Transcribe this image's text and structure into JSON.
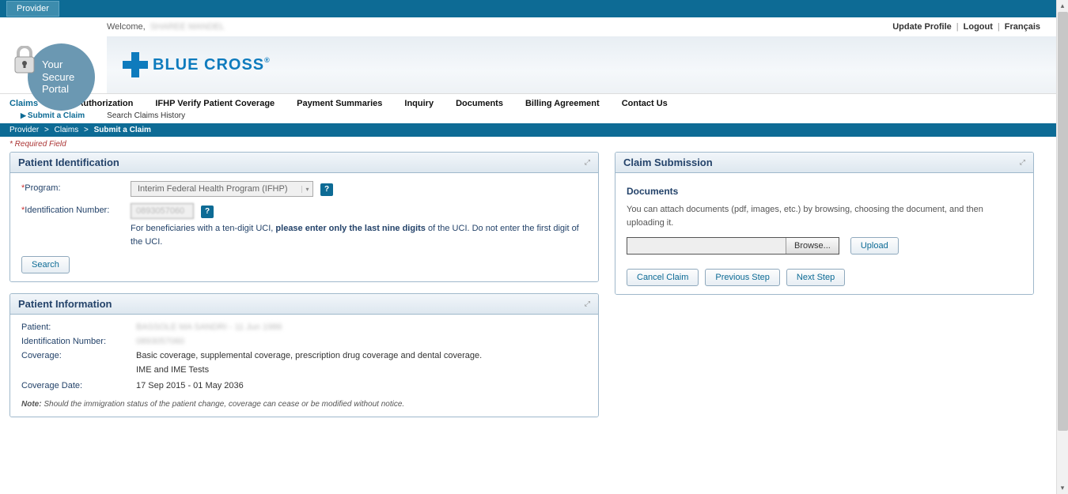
{
  "topbar": {
    "tab": "Provider"
  },
  "header": {
    "welcome_label": "Welcome,",
    "user_name": "SHAREE MANDEL",
    "links": {
      "update_profile": "Update Profile",
      "logout": "Logout",
      "francais": "Français"
    },
    "badge": {
      "line1": "Your",
      "line2": "Secure",
      "line3": "Portal"
    },
    "brand": "BLUE CROSS"
  },
  "nav": {
    "items": [
      "Claims",
      "Pre-Authorization",
      "IFHP Verify Patient Coverage",
      "Payment Summaries",
      "Inquiry",
      "Documents",
      "Billing Agreement",
      "Contact Us"
    ],
    "sub": {
      "submit": "Submit a Claim",
      "search": "Search Claims History"
    }
  },
  "breadcrumb": {
    "a": "Provider",
    "b": "Claims",
    "c": "Submit a Claim"
  },
  "required_note": "* Required Field",
  "patient_id": {
    "title": "Patient Identification",
    "program_label": "Program:",
    "program_value": "Interim Federal Health Program (IFHP)",
    "idnum_label": "Identification Number:",
    "idnum_value": "0893057060",
    "hint_pre": "For beneficiaries with a ten-digit UCI, ",
    "hint_bold": "please enter only the last nine digits",
    "hint_post": " of the UCI. Do not enter the first digit of the UCI.",
    "search_btn": "Search"
  },
  "patient_info": {
    "title": "Patient Information",
    "patient_label": "Patient:",
    "patient_value": "BASSOLE MA SANDRI - 11 Jun 1986",
    "idnum_label": "Identification Number:",
    "idnum_value": "0893057060",
    "coverage_label": "Coverage:",
    "coverage_value1": "Basic coverage, supplemental coverage, prescription drug coverage and dental coverage.",
    "coverage_value2": "IME and IME Tests",
    "coverage_date_label": "Coverage Date:",
    "coverage_date_value": "17 Sep 2015 - 01 May 2036",
    "note_label": "Note:",
    "note_text": " Should the immigration status of the patient change, coverage can cease or be modified without notice."
  },
  "claim": {
    "title": "Claim Submission",
    "docs_heading": "Documents",
    "docs_text": "You can attach documents (pdf, images, etc.) by browsing, choosing the document, and then uploading it.",
    "browse": "Browse...",
    "upload": "Upload",
    "cancel": "Cancel Claim",
    "prev": "Previous Step",
    "next": "Next Step"
  }
}
